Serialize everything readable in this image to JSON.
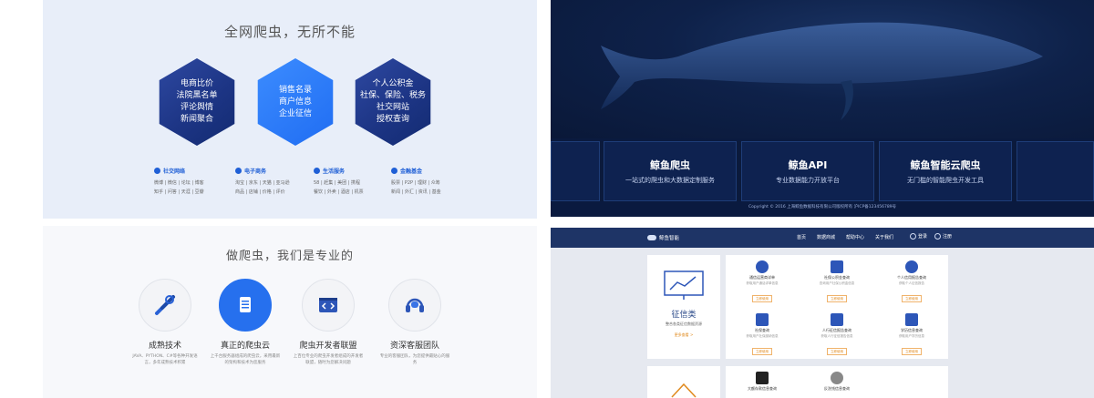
{
  "left_top": {
    "heading": "全网爬虫，无所不能",
    "hexagons": [
      {
        "lines": [
          "电商比价",
          "法院黑名单",
          "评论舆情",
          "新闻聚合"
        ]
      },
      {
        "lines": [
          "销售名录",
          "商户信息",
          "企业征信"
        ]
      },
      {
        "lines": [
          "个人公积金",
          "社保、保险、税务",
          "社交网站",
          "授权查询"
        ]
      }
    ],
    "categories": [
      {
        "title": "社交网络",
        "rows": [
          "微博 | 微信 | 论坛 | 博客",
          "知乎 | 问答 | 天涯 | 豆瓣"
        ]
      },
      {
        "title": "电子商务",
        "rows": [
          "淘宝 | 京东 | 天猫 | 亚马逊",
          "商品 | 店铺 | 价格 | 评价"
        ]
      },
      {
        "title": "生活服务",
        "rows": [
          "58 | 赶集 | 美团 | 携程",
          "餐饮 | 外卖 | 酒店 | 机票"
        ]
      },
      {
        "title": "金融基金",
        "rows": [
          "股票 | P2P | 理财 | 众筹",
          "新闻 | 外汇 | 资讯 | 基金"
        ]
      }
    ]
  },
  "left_bottom": {
    "heading": "做爬虫，我们是专业的",
    "features": [
      {
        "name": "成熟技术",
        "desc": "JAVA、PYTHON、C#等各种开发语言，多年成熟技术积累"
      },
      {
        "name": "真正的爬虫云",
        "desc": "上千台服务器组成的爬虫云，采用最新的架构和技术为您服务"
      },
      {
        "name": "爬虫开发者联盟",
        "desc": "上百位专业的爬虫开发者组成的开发者联盟，随时为您解决问题"
      },
      {
        "name": "资深客服团队",
        "desc": "专业的客服团队，为您提供最贴心的服务"
      }
    ]
  },
  "right_top": {
    "cards": [
      {
        "title": "鲸鱼爬虫",
        "sub": "一站式的爬虫和大数据定制服务"
      },
      {
        "title": "鲸鱼API",
        "sub": "专业数据能力开放平台"
      },
      {
        "title": "鲸鱼智能云爬虫",
        "sub": "无门槛的智能爬虫开发工具"
      }
    ],
    "footer": "Copyright © 2016 上海鲸鱼数据科技有限公司版权所有 沪ICP备123456789号"
  },
  "right_bottom": {
    "logo": "鲸鱼智能",
    "nav": [
      "首页",
      "数据商城",
      "帮助中心",
      "关于我们"
    ],
    "auth": [
      "登录",
      "注册"
    ],
    "side": {
      "title": "征信类",
      "sub": "整合各类征信数据资源",
      "link": "更多查看 >"
    },
    "services": [
      {
        "name": "通信运营商详单",
        "desc": "获取用户通话详单信息",
        "btn": "立即使用"
      },
      {
        "name": "社保公积金查询",
        "desc": "查询用户社保公积金信息",
        "btn": "立即使用"
      },
      {
        "name": "个人信用报告查询",
        "desc": "获取个人征信报告",
        "btn": "立即使用"
      },
      {
        "name": "社保查询",
        "desc": "获取用户社保缴纳信息",
        "btn": "立即使用"
      },
      {
        "name": "人行征信报告查询",
        "desc": "获取人行征信报告信息",
        "btn": "立即使用"
      },
      {
        "name": "学历信息查询",
        "desc": "获取用户学历信息",
        "btn": "立即使用"
      },
      {
        "name": "大额存款信息查询",
        "desc": "",
        "btn": ""
      },
      {
        "name": "反洗钱信息查询",
        "desc": "",
        "btn": ""
      }
    ]
  }
}
